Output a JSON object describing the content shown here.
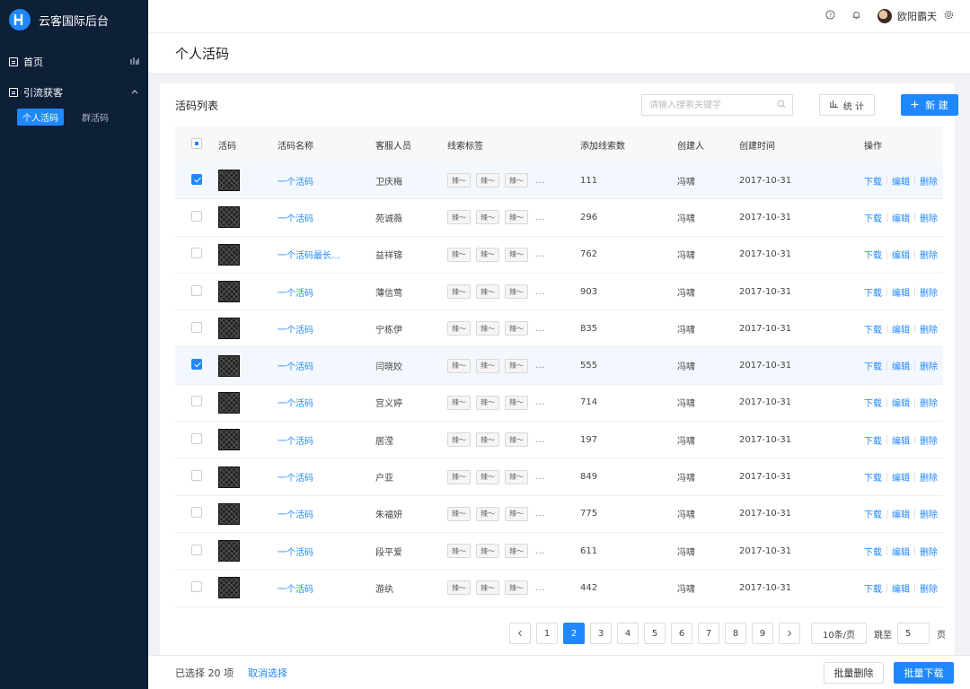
{
  "brand": {
    "title": "云客国际后台",
    "logo_letter": "H"
  },
  "sidebar": {
    "items": [
      {
        "label": "首页",
        "right_icon": "bar-chart-icon"
      },
      {
        "label": "引流获客",
        "right_icon": "chevron-up-icon"
      }
    ],
    "sub_items": [
      {
        "label": "个人活码",
        "active": true
      },
      {
        "label": "群活码",
        "active": false
      }
    ]
  },
  "header": {
    "help_icon": "?",
    "bell_icon": "bell",
    "username": "欧阳霸天",
    "settings_icon": "gear"
  },
  "page": {
    "title": "个人活码"
  },
  "card": {
    "title": "活码列表",
    "search_placeholder": "请输入搜索关键字",
    "stat_label": "统 计",
    "new_label": "新 建"
  },
  "table": {
    "columns": [
      "活码",
      "活码名称",
      "客服人员",
      "线索标签",
      "添加线索数",
      "创建人",
      "创建时间",
      "操作"
    ],
    "tag_label": "辣～",
    "ellipsis": "…",
    "ops": [
      "下载",
      "编辑",
      "删除"
    ],
    "rows": [
      {
        "checked": true,
        "name": "一个活码",
        "agent": "卫庆梅",
        "count": "111",
        "creator": "冯啸",
        "time": "2017-10-31"
      },
      {
        "checked": false,
        "name": "一个活码",
        "agent": "苑诚薇",
        "count": "296",
        "creator": "冯啸",
        "time": "2017-10-31"
      },
      {
        "checked": false,
        "name": "一个活码最长…",
        "agent": "益祥锦",
        "count": "762",
        "creator": "冯啸",
        "time": "2017-10-31"
      },
      {
        "checked": false,
        "name": "一个活码",
        "agent": "薄信莺",
        "count": "903",
        "creator": "冯啸",
        "time": "2017-10-31"
      },
      {
        "checked": false,
        "name": "一个活码",
        "agent": "宁栋伊",
        "count": "835",
        "creator": "冯啸",
        "time": "2017-10-31"
      },
      {
        "checked": true,
        "name": "一个活码",
        "agent": "闫晓姣",
        "count": "555",
        "creator": "冯啸",
        "time": "2017-10-31"
      },
      {
        "checked": false,
        "name": "一个活码",
        "agent": "宫义婷",
        "count": "714",
        "creator": "冯啸",
        "time": "2017-10-31"
      },
      {
        "checked": false,
        "name": "一个活码",
        "agent": "居滢",
        "count": "197",
        "creator": "冯啸",
        "time": "2017-10-31"
      },
      {
        "checked": false,
        "name": "一个活码",
        "agent": "户亚",
        "count": "849",
        "creator": "冯啸",
        "time": "2017-10-31"
      },
      {
        "checked": false,
        "name": "一个活码",
        "agent": "朱福妍",
        "count": "775",
        "creator": "冯啸",
        "time": "2017-10-31"
      },
      {
        "checked": false,
        "name": "一个活码",
        "agent": "段平爱",
        "count": "611",
        "creator": "冯啸",
        "time": "2017-10-31"
      },
      {
        "checked": false,
        "name": "一个活码",
        "agent": "游纨",
        "count": "442",
        "creator": "冯啸",
        "time": "2017-10-31"
      }
    ]
  },
  "pagination": {
    "pages": [
      "1",
      "2",
      "3",
      "4",
      "5",
      "6",
      "7",
      "8",
      "9"
    ],
    "current": "2",
    "page_size": "10条/页",
    "jump_label": "跳至",
    "jump_value": "5",
    "page_unit": "页"
  },
  "footer": {
    "selected_text": "已选择 20 项",
    "cancel_label": "取消选择",
    "batch_delete_label": "批量删除",
    "batch_download_label": "批量下载"
  },
  "colors": {
    "primary": "#1f88ff",
    "sidebar_bg": "#0e1f38"
  }
}
